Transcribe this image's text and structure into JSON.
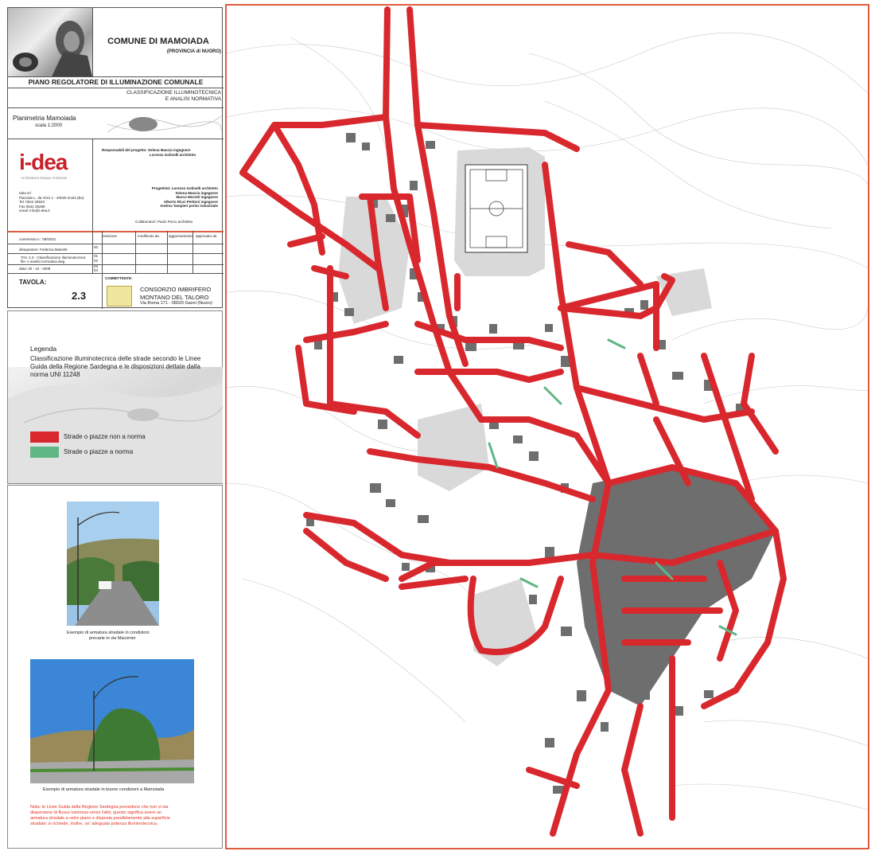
{
  "title_block": {
    "comune": "COMUNE DI MAMOIADA",
    "provincia": "(PROVINCIA di NUORO)",
    "piano": "PIANO REGOLATORE DI ILLUMINAZIONE COMUNALE",
    "sub_title_1": "CLASSIFICAZIONE ILLUMINOTECNICA",
    "sub_title_2": "E ANALISI NORMATIVA",
    "planimetria": "Planimetria Mamoiada",
    "scale": "scala 1:2000",
    "logo_text": "i-dea",
    "logo_tagline": "Architettura  Design  Ambiente",
    "company_lines": [
      "Idea srl",
      "Piazzale L. da Vinci 1 - 40026 Imola (Bo)",
      "Tel. 0542 28843",
      "Fax 0542 35288",
      "",
      "email: info@i-dea.it"
    ],
    "responsabili_label": "Responsabili del progetto:",
    "responsabili": [
      "Selena Mascia ingegnere",
      "Lorenzo Golinelli architetto"
    ],
    "progettisti_label": "Progettisti:",
    "progettisti": [
      "Lorenzo Golinelli architetto",
      "Selena Mascia ingegnere",
      "Marco Morotti ingegnere",
      "Alberto Ricci Petitoni ingegnere",
      "Andrea Tampieri perito industriale"
    ],
    "collaboratori": "Collaboratori: Paolo Porcu architetto",
    "commessa": "commessa n.: 08/D031",
    "disegnatore": "disegnatore: Federica Mainetti",
    "tav_file": "TAV. 2.3 - Classificazione illuminotecnica",
    "file_name": "file: e analisi normativa.dwg",
    "data": "data: 30 - 10 - 2008",
    "rev_headers": [
      "revisione",
      "modificato da",
      "aggiornamento",
      "approvato da"
    ],
    "rev_numbers": [
      "00",
      "01",
      "02",
      "03",
      "04"
    ],
    "tavola_label": "TAVOLA:",
    "tavola_num": "2.3",
    "committente_label": "COMMITTENTE:",
    "committente_1": "CONSORZIO IMBRIFERO",
    "committente_2": "MONTANO DEL TALORO",
    "committente_addr": "Via Roma 171 - 08020 Gavoi (Nuoro)"
  },
  "legend": {
    "title": "Legenda",
    "description": "Classificazione illuminotecnica delle strade secondo le Linee Guida della Regione Sardegna e le disposizioni dettate dalla norma UNI 11248",
    "items": [
      {
        "label": "Strade o piazze non a norma",
        "color": "#d8282e"
      },
      {
        "label": "Strade o piazze a norma",
        "color": "#5fb784"
      }
    ]
  },
  "photos": {
    "caption_1a": "Esempio di armatura stradale in condizioni",
    "caption_1b": "precarie  in via Macomer",
    "caption_2": "Esempio di armatura stradale in buone condizioni a Mamoiada"
  },
  "note": {
    "text_1": "Nota: le Linee Guida della Regione Sardegna prevedono che non vi sia",
    "text_2": "dispersione di flusso luminoso verso l'alto; questo significa avere un",
    "text_3": "armatura stradale a vetro piano e disposta parallelamente alla superficie",
    "text_4": "stradale; si richiede, inoltre, un' adeguata potenza illuminotecnica."
  },
  "colors": {
    "frame": "#e05a40",
    "road_non_norma": "#d8282e",
    "road_norma": "#5fb784",
    "building": "#6e6e6e",
    "open_area": "#d9d9d9",
    "note_text": "#e0301e"
  }
}
